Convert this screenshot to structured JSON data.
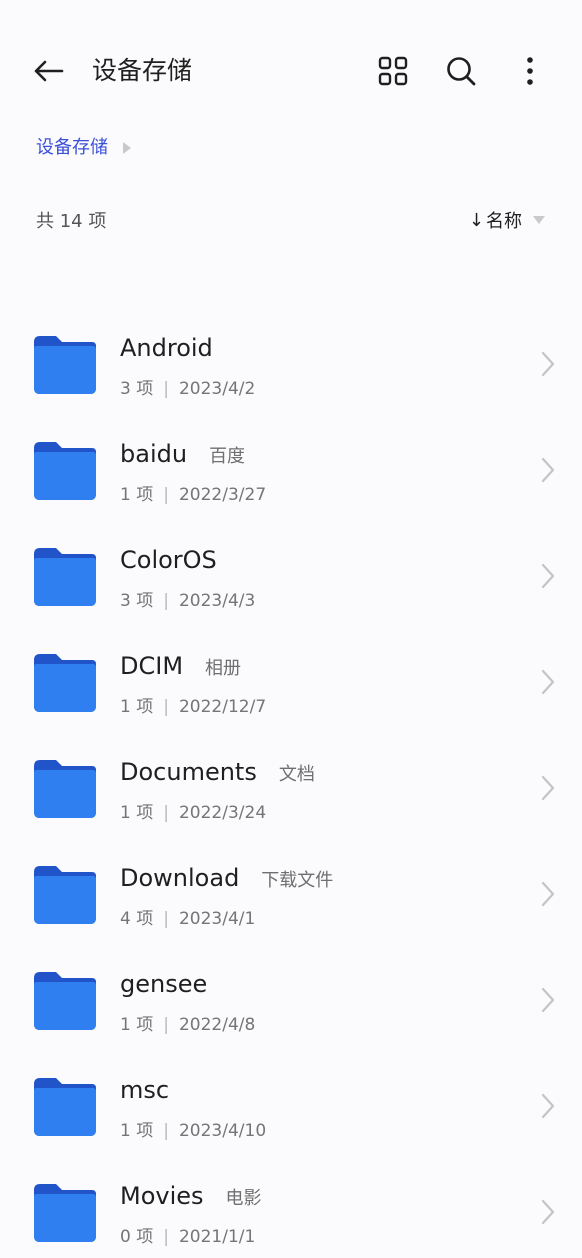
{
  "header": {
    "title": "设备存储",
    "back_icon": "back-arrow-icon",
    "grid_icon": "grid-view-icon",
    "search_icon": "search-icon",
    "more_icon": "more-vertical-icon"
  },
  "breadcrumb": {
    "label": "设备存储"
  },
  "summary": {
    "count_label": "共 14 项",
    "sort_arrow": "↓",
    "sort_label": "名称"
  },
  "colors": {
    "accent": "#3b50d8",
    "folder_front": "#2f7ff0",
    "folder_back": "#2254c9"
  },
  "folders": [
    {
      "name": "Android",
      "alias": "",
      "count": "3 项",
      "date": "2023/4/2"
    },
    {
      "name": "baidu",
      "alias": "百度",
      "count": "1 项",
      "date": "2022/3/27"
    },
    {
      "name": "ColorOS",
      "alias": "",
      "count": "3 项",
      "date": "2023/4/3"
    },
    {
      "name": "DCIM",
      "alias": "相册",
      "count": "1 项",
      "date": "2022/12/7"
    },
    {
      "name": "Documents",
      "alias": "文档",
      "count": "1 项",
      "date": "2022/3/24"
    },
    {
      "name": "Download",
      "alias": "下载文件",
      "count": "4 项",
      "date": "2023/4/1"
    },
    {
      "name": "gensee",
      "alias": "",
      "count": "1 项",
      "date": "2022/4/8"
    },
    {
      "name": "msc",
      "alias": "",
      "count": "1 项",
      "date": "2023/4/10"
    },
    {
      "name": "Movies",
      "alias": "电影",
      "count": "0 项",
      "date": "2021/1/1"
    }
  ],
  "separator": "|"
}
